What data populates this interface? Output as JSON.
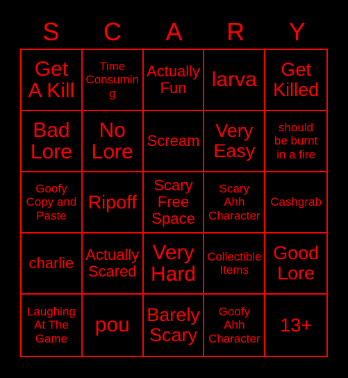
{
  "card": {
    "title_letters": [
      "S",
      "C",
      "A",
      "R",
      "Y"
    ],
    "theme": {
      "background_color": "#000000",
      "text_color": "#ff0000",
      "border_color": "#ff0000"
    },
    "grid_size": "5x5",
    "free_space_label": "Scary Free Space"
  },
  "cells": [
    {
      "text": "Get\nA Kill",
      "size": "xl",
      "row": 1,
      "col": 1
    },
    {
      "text": "Time\nConsuming",
      "size": "sm",
      "row": 1,
      "col": 2
    },
    {
      "text": "Actually\nFun",
      "size": "md",
      "row": 1,
      "col": 3
    },
    {
      "text": "larva",
      "size": "xl",
      "row": 1,
      "col": 4
    },
    {
      "text": "Get\nKilled",
      "size": "lg",
      "row": 1,
      "col": 5
    },
    {
      "text": "Bad\nLore",
      "size": "xl",
      "row": 2,
      "col": 1
    },
    {
      "text": "No\nLore",
      "size": "xl",
      "row": 2,
      "col": 2
    },
    {
      "text": "Scream",
      "size": "md",
      "row": 2,
      "col": 3
    },
    {
      "text": "Very\nEasy",
      "size": "lg",
      "row": 2,
      "col": 4
    },
    {
      "text": "should\nbe burnt\nin a fire",
      "size": "sm",
      "row": 2,
      "col": 5
    },
    {
      "text": "Goofy\nCopy and\nPaste",
      "size": "sm",
      "row": 3,
      "col": 1
    },
    {
      "text": "Ripoff",
      "size": "lg",
      "row": 3,
      "col": 2
    },
    {
      "text": "Scary\nFree\nSpace",
      "size": "md",
      "row": 3,
      "col": 3
    },
    {
      "text": "Scary\nAhh\nCharacter",
      "size": "sm",
      "row": 3,
      "col": 4
    },
    {
      "text": "Cashgrab",
      "size": "sm",
      "row": 3,
      "col": 5
    },
    {
      "text": "charlie",
      "size": "md",
      "row": 4,
      "col": 1
    },
    {
      "text": "Actually\nScared",
      "size": "md",
      "row": 4,
      "col": 2
    },
    {
      "text": "Very\nHard",
      "size": "xl",
      "row": 4,
      "col": 3
    },
    {
      "text": "Collectible\nItems",
      "size": "sm",
      "row": 4,
      "col": 4
    },
    {
      "text": "Good\nLore",
      "size": "lg",
      "row": 4,
      "col": 5
    },
    {
      "text": "Laughing\nAt The\nGame",
      "size": "sm",
      "row": 5,
      "col": 1
    },
    {
      "text": "pou",
      "size": "xl",
      "row": 5,
      "col": 2
    },
    {
      "text": "Barely\nScary",
      "size": "lg",
      "row": 5,
      "col": 3
    },
    {
      "text": "Goofy\nAhh\nCharacter",
      "size": "sm",
      "row": 5,
      "col": 4
    },
    {
      "text": "13+",
      "size": "lg",
      "row": 5,
      "col": 5
    }
  ]
}
